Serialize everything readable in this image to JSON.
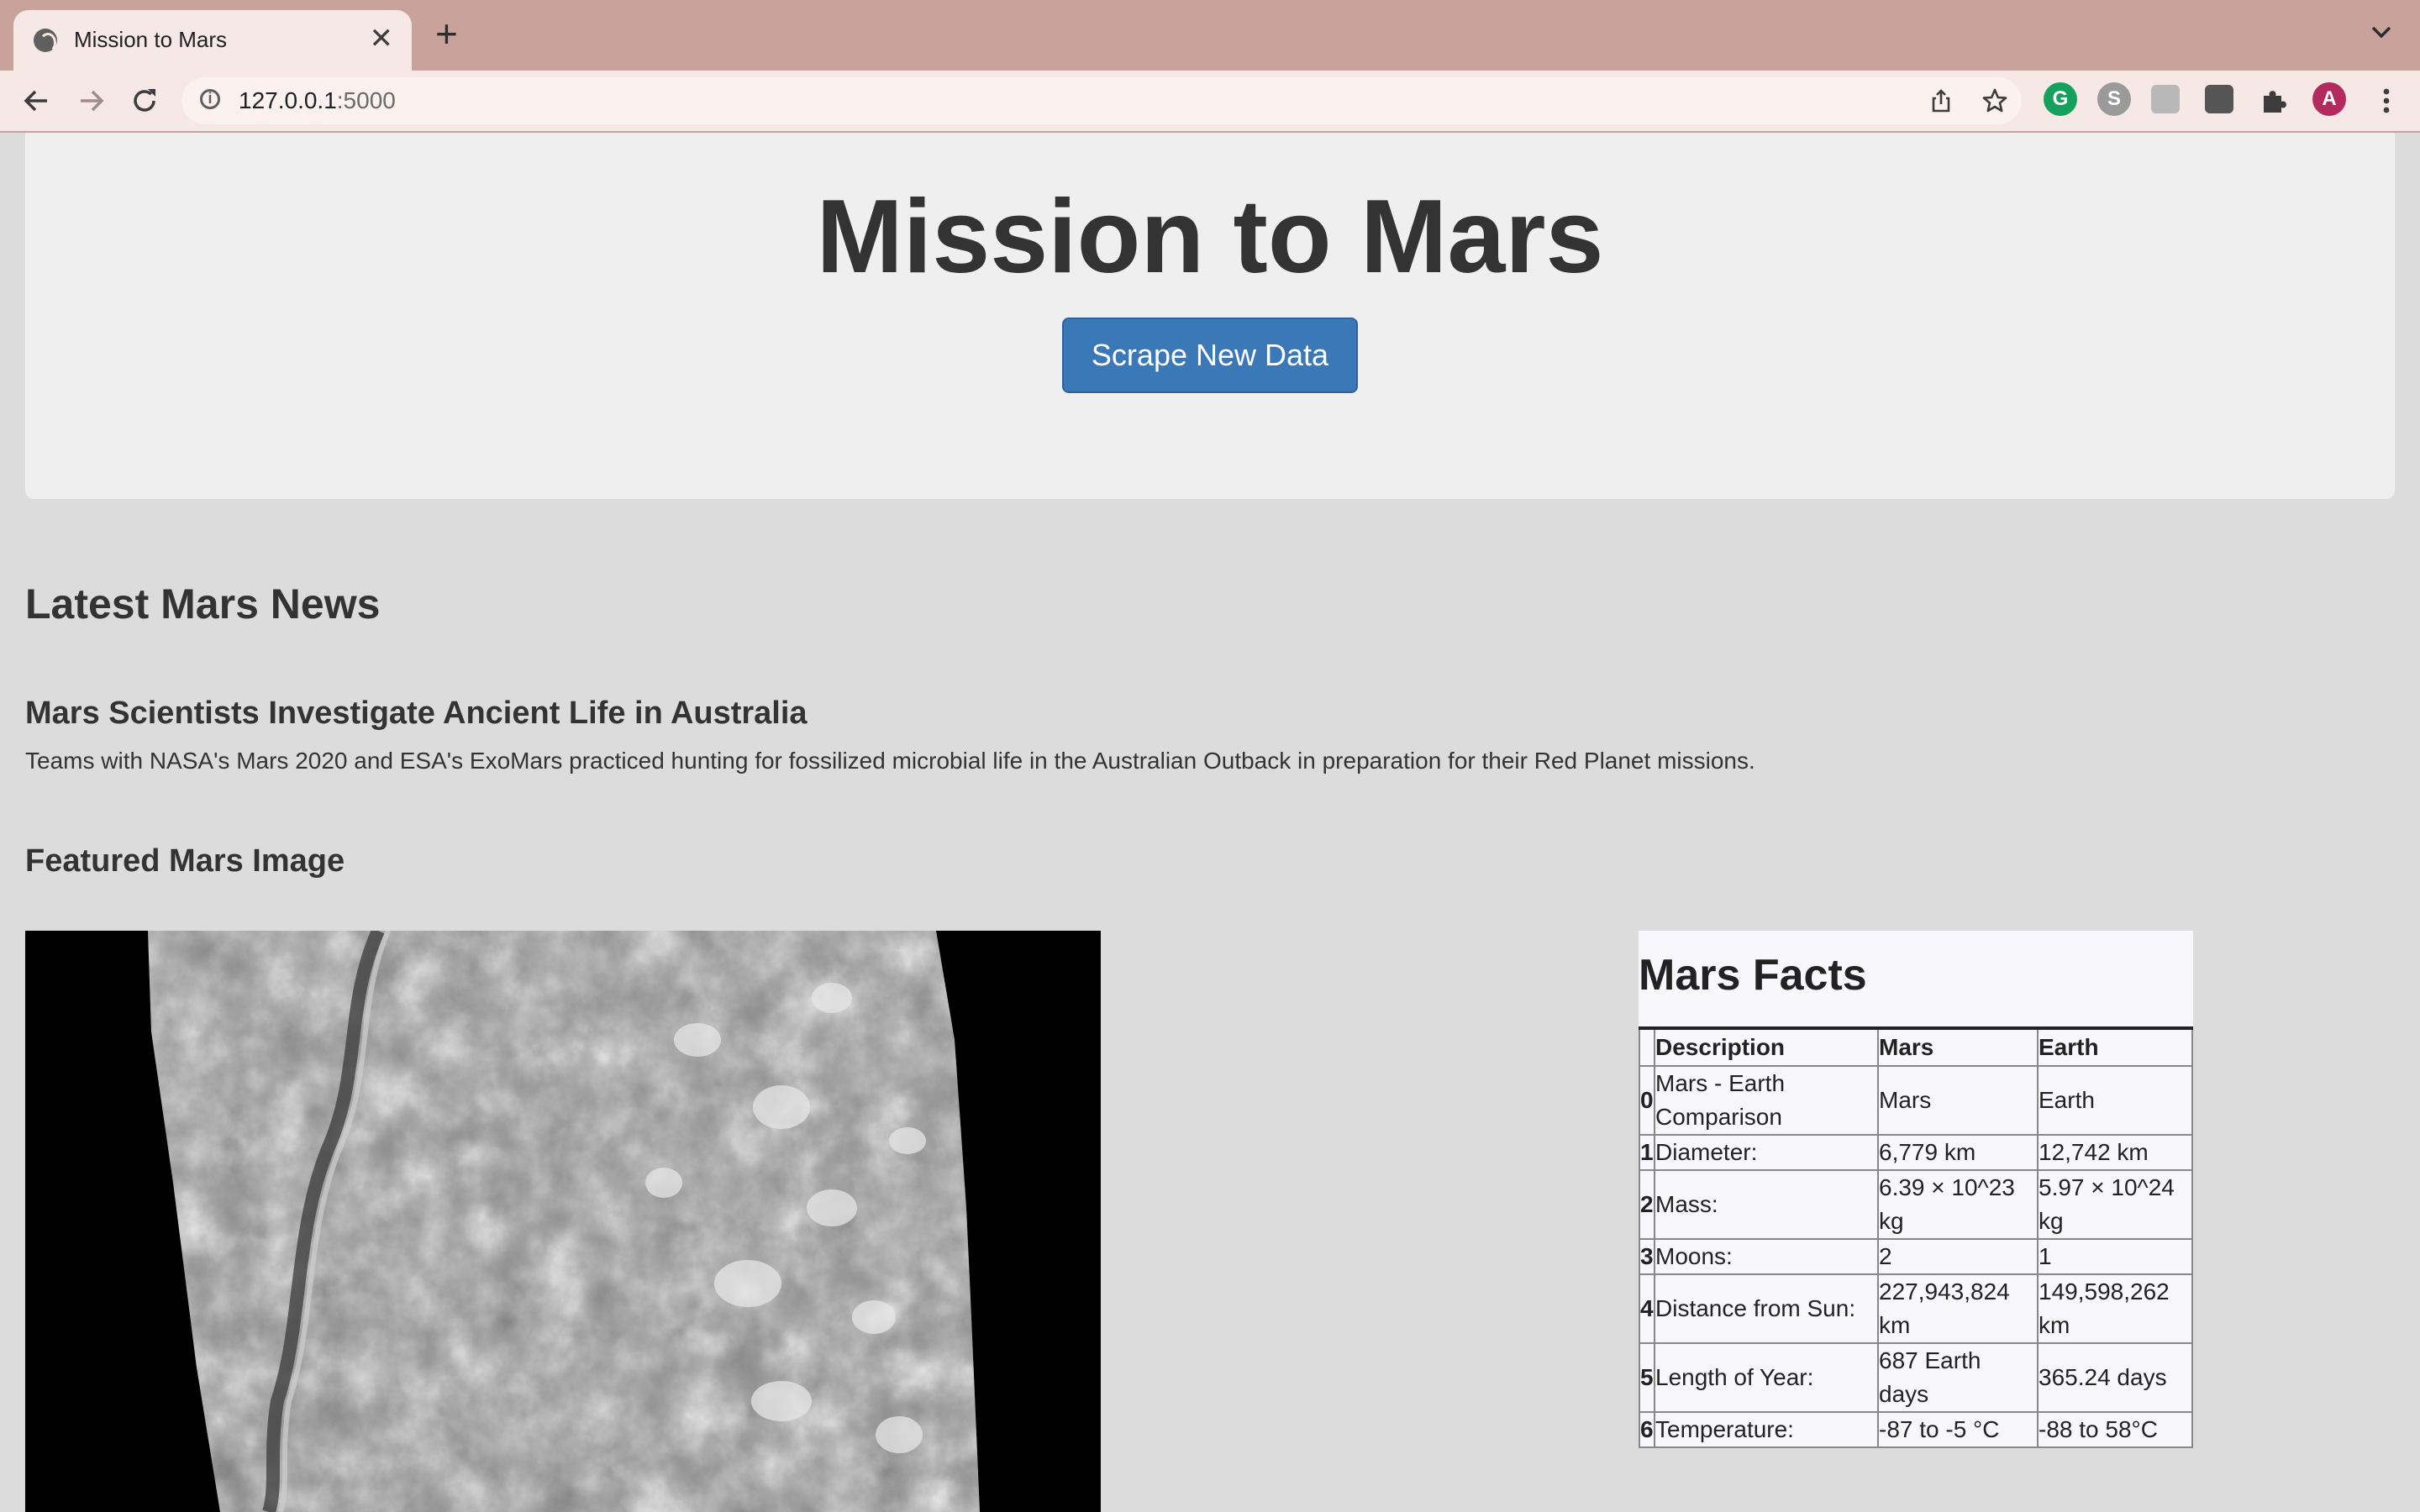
{
  "browser": {
    "tab_title": "Mission to Mars",
    "url_host": "127.0.0.1",
    "url_port": ":5000",
    "profile_initial": "A"
  },
  "colors": {
    "chrome_frame": "#c9a29c",
    "chrome_tab": "#f6e8e5",
    "primary_button": "#3b78b8",
    "page_bg": "#dcdcdc",
    "jumbotron_bg": "#efefef"
  },
  "page": {
    "title": "Mission to Mars",
    "scrape_button": "Scrape New Data",
    "news_heading": "Latest Mars News",
    "news_title": "Mars Scientists Investigate Ancient Life in Australia",
    "news_paragraph": "Teams with NASA's Mars 2020 and ESA's ExoMars practiced hunting for fossilized microbial life in the Australian Outback in preparation for their Red Planet missions.",
    "image_heading": "Featured Mars Image"
  },
  "facts": {
    "title": "Mars Facts",
    "headers": [
      "Description",
      "Mars",
      "Earth"
    ],
    "rows": [
      {
        "index": "0",
        "description": "Mars - Earth Comparison",
        "mars": "Mars",
        "earth": "Earth"
      },
      {
        "index": "1",
        "description": "Diameter:",
        "mars": "6,779 km",
        "earth": "12,742 km"
      },
      {
        "index": "2",
        "description": "Mass:",
        "mars": "6.39 × 10^23 kg",
        "earth": "5.97 × 10^24 kg"
      },
      {
        "index": "3",
        "description": "Moons:",
        "mars": "2",
        "earth": "1"
      },
      {
        "index": "4",
        "description": "Distance from Sun:",
        "mars": "227,943,824 km",
        "earth": "149,598,262 km"
      },
      {
        "index": "5",
        "description": "Length of Year:",
        "mars": "687 Earth days",
        "earth": "365.24 days"
      },
      {
        "index": "6",
        "description": "Temperature:",
        "mars": "-87 to -5 °C",
        "earth": "-88 to 58°C"
      }
    ]
  }
}
